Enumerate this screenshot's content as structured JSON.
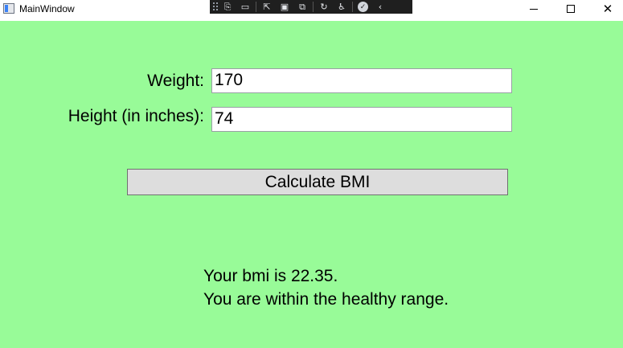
{
  "window": {
    "title": "MainWindow"
  },
  "dev_toolbar": {
    "icons": [
      "live-visual-tree-icon",
      "record-icon",
      "select-element-icon",
      "display-layout-adorners-icon",
      "track-focus-icon",
      "hot-reload-icon",
      "accessibility-icon",
      "binding-check-icon",
      "collapse-icon"
    ]
  },
  "form": {
    "weight_label": "Weight:",
    "weight_value": "170",
    "height_label": "Height (in inches):",
    "height_value": "74",
    "calculate_label": "Calculate BMI"
  },
  "result": {
    "line1": "Your bmi is 22.35.",
    "line2": "You are within the healthy range."
  },
  "colors": {
    "background": "#98fb98",
    "button": "#dddddd",
    "toolbar": "#1f1f1f"
  }
}
